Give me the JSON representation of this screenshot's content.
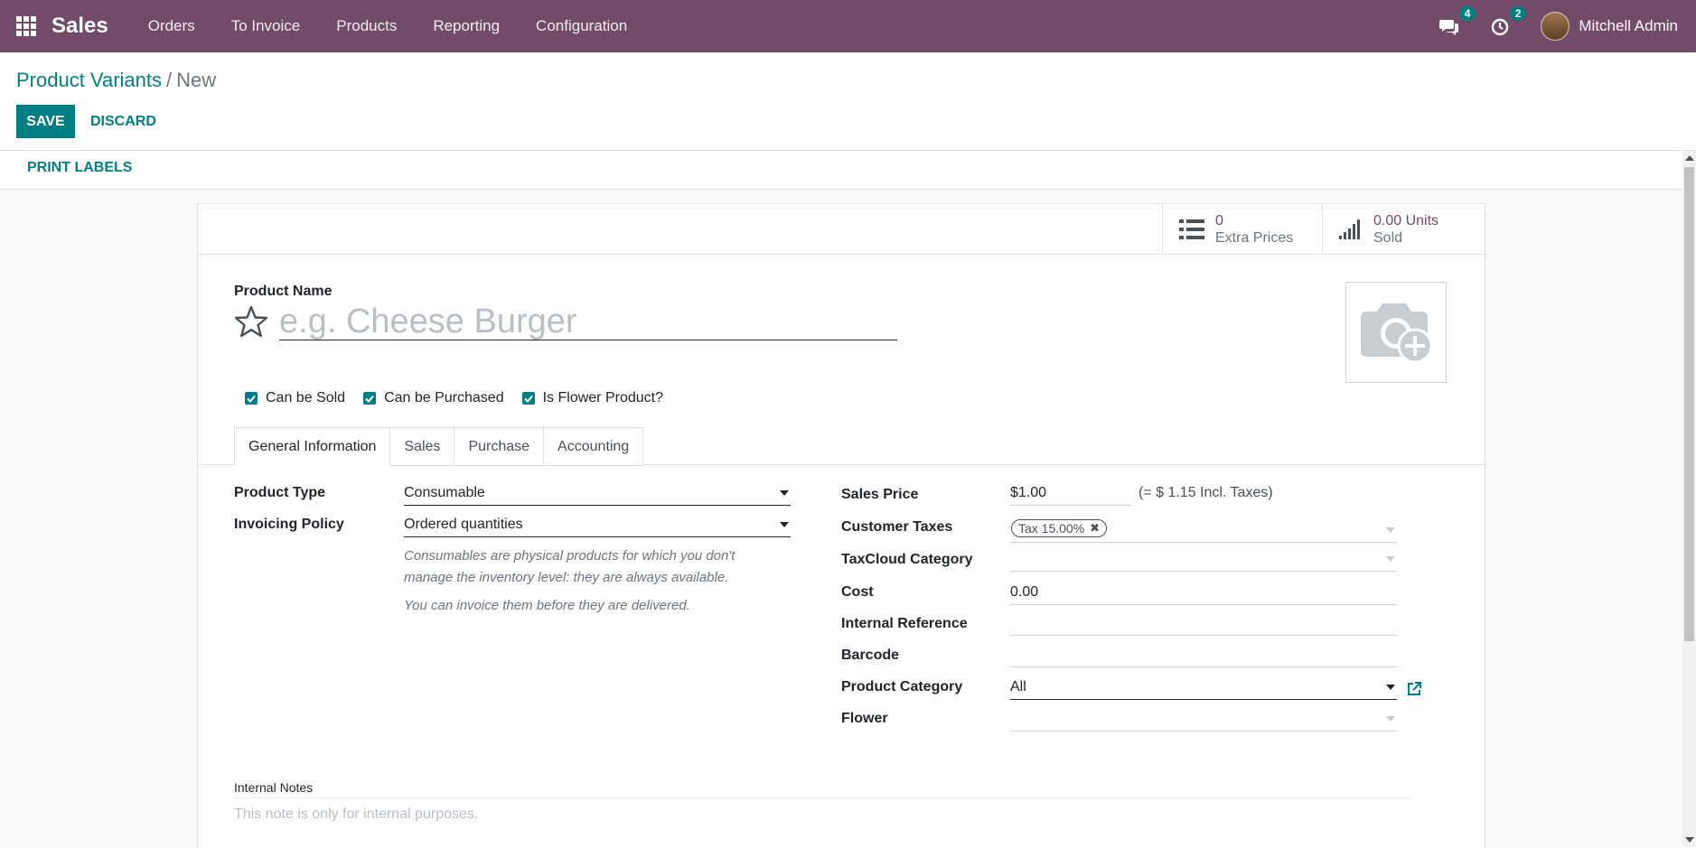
{
  "navbar": {
    "app_name": "Sales",
    "menu": [
      "Orders",
      "To Invoice",
      "Products",
      "Reporting",
      "Configuration"
    ],
    "messages_count": "4",
    "activities_count": "2",
    "user_name": "Mitchell Admin"
  },
  "breadcrumb": {
    "parent": "Product Variants",
    "separator": "/",
    "current": "New"
  },
  "actions": {
    "save_label": "SAVE",
    "discard_label": "DISCARD",
    "print_labels": "PRINT LABELS"
  },
  "stat_buttons": {
    "extra_prices_value": "0",
    "extra_prices_label": "Extra Prices",
    "sold_value": "0.00 Units",
    "sold_label": "Sold"
  },
  "product": {
    "name_label": "Product Name",
    "name_placeholder": "e.g. Cheese Burger",
    "name_value": ""
  },
  "checkboxes": [
    {
      "label": "Can be Sold",
      "checked": true
    },
    {
      "label": "Can be Purchased",
      "checked": true
    },
    {
      "label": "Is Flower Product?",
      "checked": true
    }
  ],
  "tabs": [
    "General Information",
    "Sales",
    "Purchase",
    "Accounting"
  ],
  "active_tab": "General Information",
  "left_fields": {
    "product_type_label": "Product Type",
    "product_type_value": "Consumable",
    "invoicing_policy_label": "Invoicing Policy",
    "invoicing_policy_value": "Ordered quantities",
    "help_line1": "Consumables are physical products for which you don't",
    "help_line2": "manage the inventory level: they are always available.",
    "help_line3": "You can invoice them before they are delivered."
  },
  "right_fields": {
    "sales_price_label": "Sales Price",
    "sales_price_value": "$1.00",
    "sales_price_incl": "(= $ 1.15 Incl. Taxes)",
    "customer_taxes_label": "Customer Taxes",
    "customer_taxes_tag": "Tax 15.00%",
    "taxcloud_label": "TaxCloud Category",
    "taxcloud_value": "",
    "cost_label": "Cost",
    "cost_value": "0.00",
    "internal_ref_label": "Internal Reference",
    "internal_ref_value": "",
    "barcode_label": "Barcode",
    "barcode_value": "",
    "category_label": "Product Category",
    "category_value": "All",
    "flower_label": "Flower",
    "flower_value": ""
  },
  "notes": {
    "label": "Internal Notes",
    "placeholder": "This note is only for internal purposes."
  },
  "colors": {
    "navbar": "#714b67",
    "primary": "#017e84",
    "stat_value": "#714b67"
  }
}
